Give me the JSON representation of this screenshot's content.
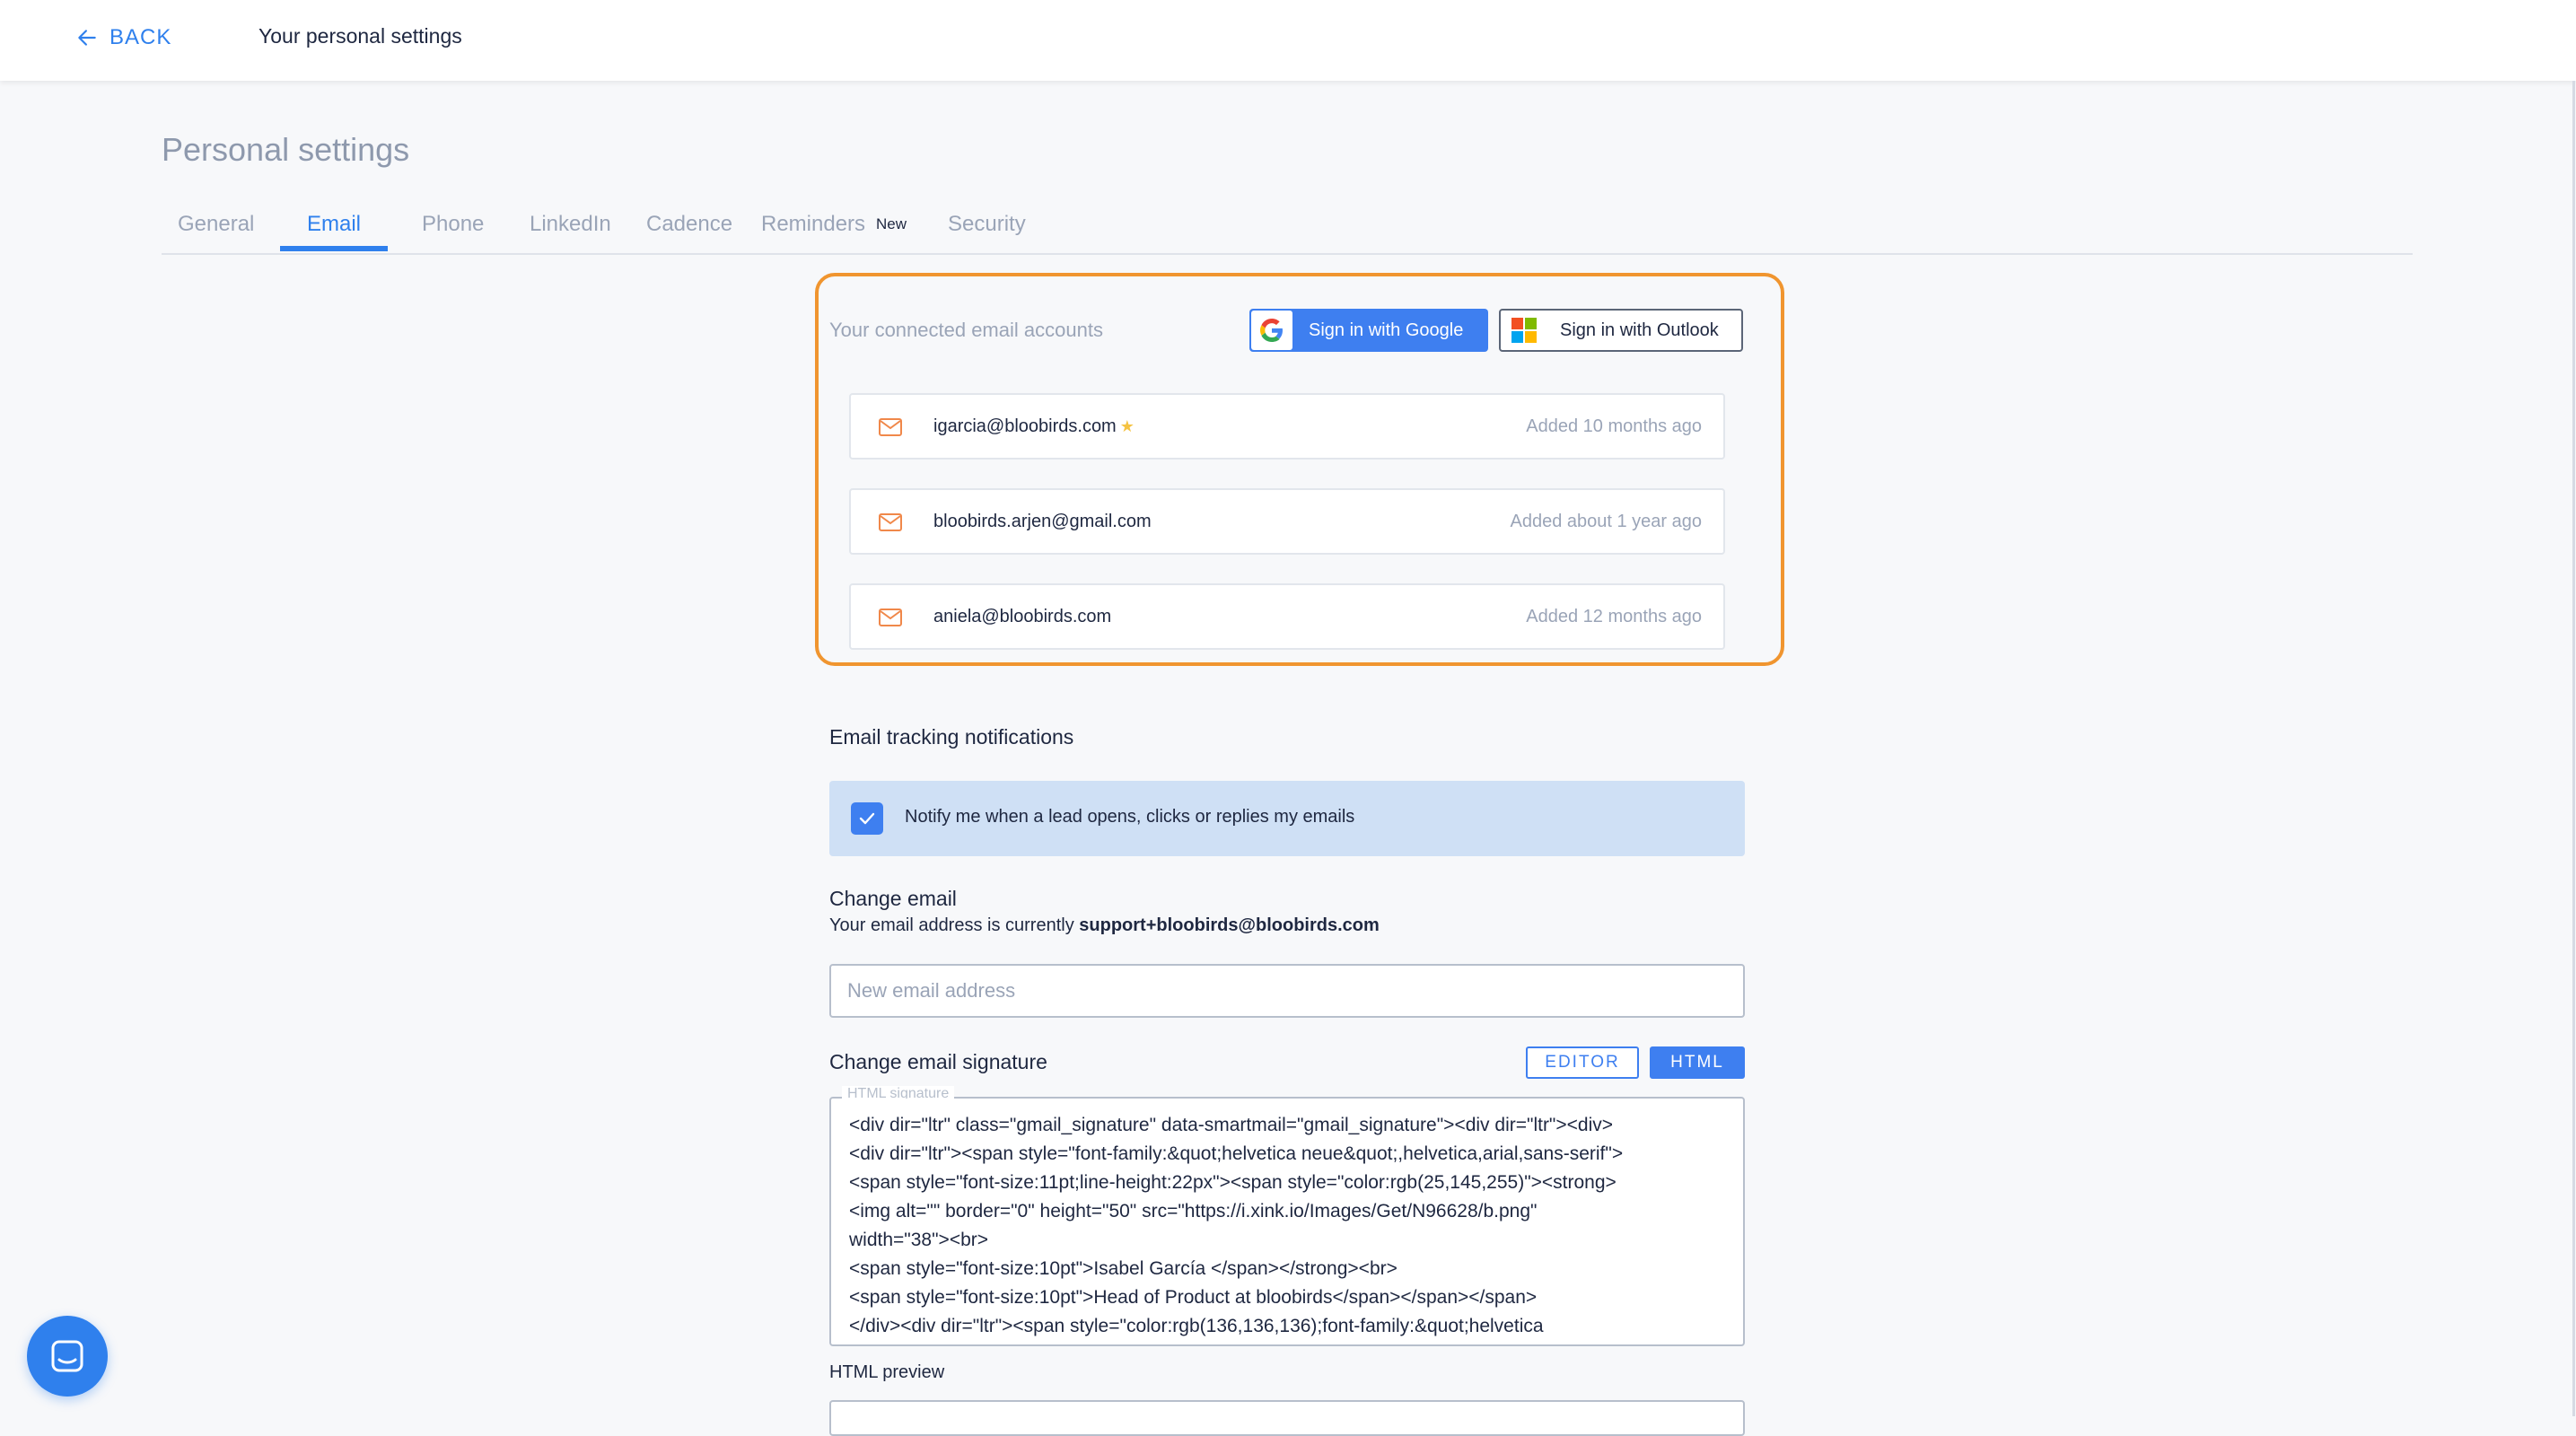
{
  "header": {
    "back_label": "BACK",
    "title": "Your personal settings"
  },
  "page": {
    "title": "Personal settings"
  },
  "tabs": [
    {
      "label": "General",
      "active": false
    },
    {
      "label": "Email",
      "active": true
    },
    {
      "label": "Phone",
      "active": false
    },
    {
      "label": "LinkedIn",
      "active": false
    },
    {
      "label": "Cadence",
      "active": false
    },
    {
      "label": "Reminders",
      "active": false,
      "badge": "New"
    },
    {
      "label": "Security",
      "active": false
    }
  ],
  "connected_accounts": {
    "label": "Your connected email accounts",
    "google_button": "Sign in with Google",
    "outlook_button": "Sign in with Outlook",
    "accounts": [
      {
        "email": "igarcia@bloobirds.com",
        "added": "Added 10 months ago",
        "starred": true,
        "icon": "mail-icon"
      },
      {
        "email": "bloobirds.arjen@gmail.com",
        "added": "Added about 1 year ago",
        "starred": false,
        "icon": "mail-icon"
      },
      {
        "email": "aniela@bloobirds.com",
        "added": "Added 12 months ago",
        "starred": false,
        "icon": "mail-icon"
      }
    ]
  },
  "tracking": {
    "title": "Email tracking notifications",
    "checkbox_label": "Notify me when a lead opens, clicks or replies my emails",
    "checked": true
  },
  "change_email": {
    "title": "Change email",
    "current_prefix": "Your email address is currently",
    "current_email": "support+bloobirds@bloobirds.com",
    "placeholder": "New email address"
  },
  "signature": {
    "title": "Change email signature",
    "editor_label": "EDITOR",
    "html_label": "HTML",
    "legend": "HTML signature",
    "lines": [
      "<div dir=\"ltr\" class=\"gmail_signature\" data-smartmail=\"gmail_signature\"><div dir=\"ltr\"><div>",
      "<div dir=\"ltr\"><span style=\"font-family:&quot;helvetica neue&quot;,helvetica,arial,sans-serif\">",
      "<span style=\"font-size:11pt;line-height:22px\"><span style=\"color:rgb(25,145,255)\"><strong>",
      "<img alt=\"\" border=\"0\" height=\"50\" src=\"https://i.xink.io/Images/Get/N96628/b.png\"",
      "width=\"38\"><br>",
      "<span style=\"font-size:10pt\">Isabel García </span></strong><br>",
      "<span style=\"font-size:10pt\">Head of Product at bloobirds</span></span></span>",
      "</div><div dir=\"ltr\"><span style=\"color:rgb(136,136,136);font-family:&quot;helvetica"
    ],
    "preview_label": "HTML preview"
  },
  "colors": {
    "accent": "#2f80ed",
    "highlight": "#f0952f",
    "mail_icon": "#f0884a"
  }
}
